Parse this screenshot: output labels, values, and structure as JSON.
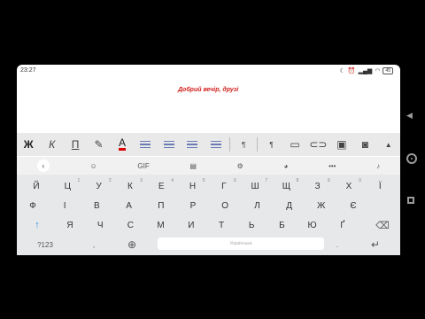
{
  "status": {
    "time": "23:27",
    "battery": "45"
  },
  "document": {
    "text": "Добрий вечір, друзі"
  },
  "toolbar": {
    "bold": "Ж",
    "italic": "К",
    "underline": "П",
    "font_color": "А",
    "para_mark_1": "¶",
    "para_mark_2": "¶",
    "accent_color": "#e00000"
  },
  "keyboard_bar": {
    "gif": "GIF"
  },
  "keyboard": {
    "row1": [
      {
        "k": "Й",
        "s": ""
      },
      {
        "k": "Ц",
        "s": "1"
      },
      {
        "k": "У",
        "s": "2"
      },
      {
        "k": "К",
        "s": "3"
      },
      {
        "k": "Е",
        "s": "4"
      },
      {
        "k": "Н",
        "s": "5"
      },
      {
        "k": "Г",
        "s": "6"
      },
      {
        "k": "Ш",
        "s": "7"
      },
      {
        "k": "Щ",
        "s": "8"
      },
      {
        "k": "З",
        "s": "9"
      },
      {
        "k": "Х",
        "s": "0"
      },
      {
        "k": "Ї",
        "s": ""
      }
    ],
    "row2": [
      "Ф",
      "І",
      "В",
      "А",
      "П",
      "Р",
      "О",
      "Л",
      "Д",
      "Ж",
      "Є"
    ],
    "row3": [
      "Я",
      "Ч",
      "С",
      "М",
      "И",
      "Т",
      "Ь",
      "Б",
      "Ю",
      "Ґ"
    ],
    "row4": {
      "symbols": "?123",
      "space": "Українська"
    }
  }
}
